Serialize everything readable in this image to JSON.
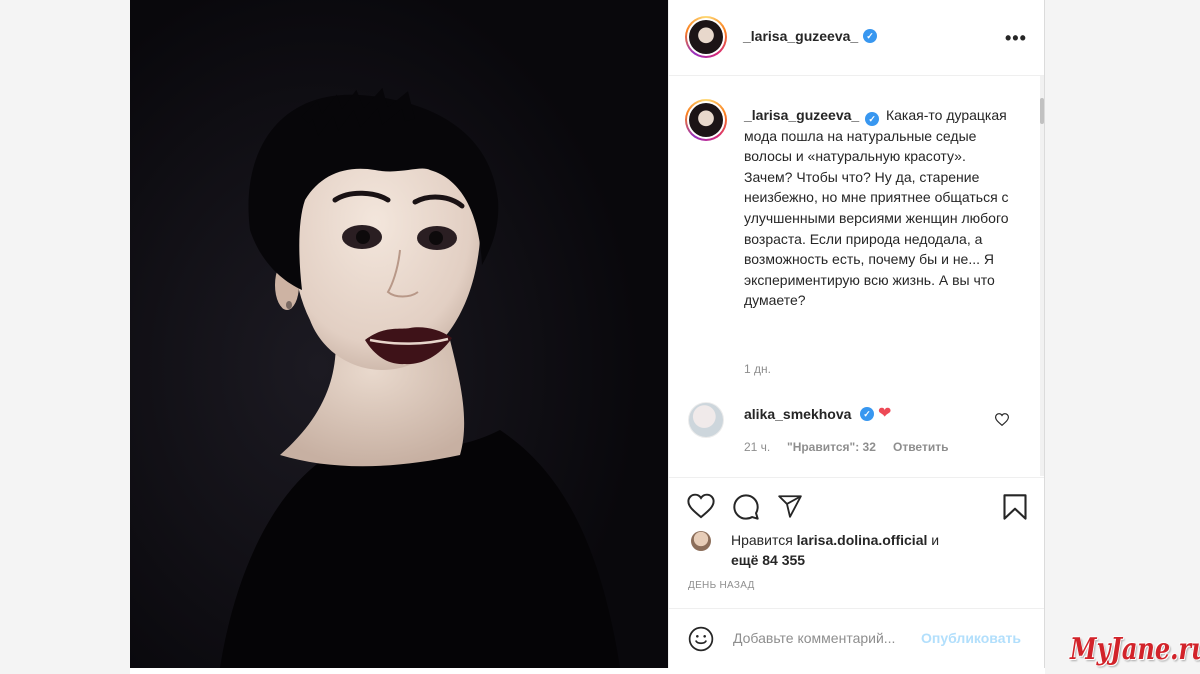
{
  "post": {
    "author": "_larisa_guzeeva_",
    "more_label": "•••",
    "caption": "Какая-то дурацкая мода пошла на натуральные седые волосы и «натуральную красоту». Зачем? Чтобы что? Ну да, старение неизбежно, но мне приятнее общаться с улучшенными версиями женщин любого возраста. Если природа недодала, а возможность есть, почему бы и не... Я экспериментирую всю жизнь. А вы что думаете?",
    "caption_age": "1 дн.",
    "verified_icon": "verified-badge-icon"
  },
  "comment": {
    "author": "alika_smekhova",
    "text": "❤",
    "age": "21 ч.",
    "likes": "\"Нравится\": 32",
    "reply": "Ответить"
  },
  "likes": {
    "prefix": "Нравится",
    "user": "larisa.dolina.official",
    "and": "и",
    "others": "ещё 84 355"
  },
  "date": "День назад",
  "add_comment": {
    "placeholder": "Добавьте комментарий...",
    "publish": "Опубликовать"
  },
  "watermark": "MyJane.ru",
  "colors": {
    "verified": "#3897f0",
    "heart": "#ed4956",
    "publish_disabled": "#b2dffc",
    "photo_bg": "#0c0b10"
  }
}
